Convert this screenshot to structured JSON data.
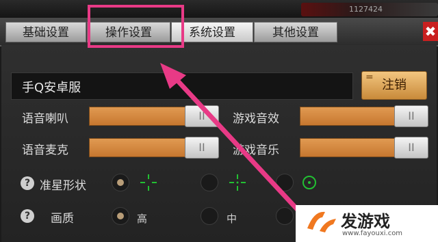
{
  "tabs": [
    {
      "label": "基础设置"
    },
    {
      "label": "操作设置"
    },
    {
      "label": "系统设置"
    },
    {
      "label": "其他设置"
    }
  ],
  "close_label": "✖",
  "top_counter": "1127424",
  "server": {
    "name": "手Q安卓服",
    "logout_label": "注销",
    "logout_marker": "="
  },
  "audio": [
    {
      "label": "语音喇叭",
      "knob": "II"
    },
    {
      "label": "游戏音效",
      "knob": "II"
    },
    {
      "label": "语音麦克",
      "knob": "II"
    },
    {
      "label": "游戏音乐",
      "knob": "II"
    }
  ],
  "crosshair": {
    "label": "准星形状",
    "help": "?",
    "selected_index": 0
  },
  "quality": {
    "label": "画质",
    "help": "?",
    "options": [
      "高",
      "中"
    ],
    "selected_index": 0
  },
  "colors": {
    "slider": "#d58a45",
    "accent": "#e83a86",
    "crosshair": "#22c032"
  },
  "watermark": {
    "title": "发游戏",
    "url": "www.fayouxi.com"
  }
}
